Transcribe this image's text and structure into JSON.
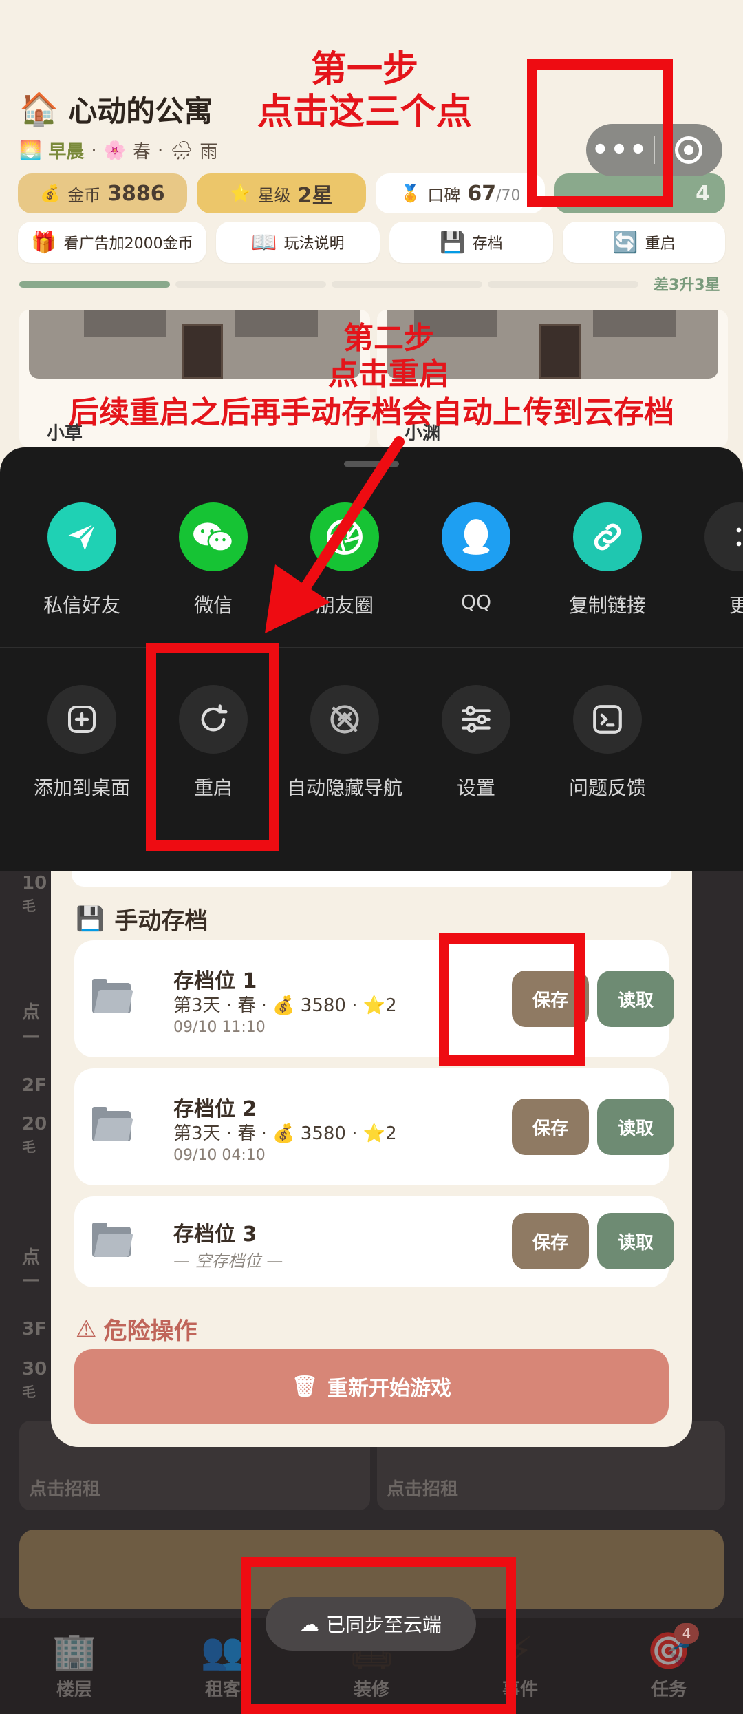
{
  "header": {
    "house_icon": "house-icon",
    "title": "心动的公寓",
    "time_of_day": "早晨",
    "season": "春",
    "weather": "雨",
    "separator": "·"
  },
  "capsule": {
    "more_label": "•••",
    "close_icon": "target-circle-icon"
  },
  "stats": {
    "gold_label": "金币",
    "gold_value": "3886",
    "star_label": "星级",
    "star_value": "2星",
    "rep_label": "口碑",
    "rep_value": "67",
    "rep_max": "/70",
    "green_value": "4"
  },
  "actions": {
    "ad": "看广告加2000金币",
    "guide": "玩法说明",
    "save": "存档",
    "restart": "重启"
  },
  "progress": {
    "filled_segments": 1,
    "total_segments": 4,
    "label": "差3升3星"
  },
  "rooms_top": [
    {
      "name": "小草"
    },
    {
      "name": "小渊"
    }
  ],
  "share_sheet": {
    "share_items": [
      {
        "label": "私信好友",
        "color": "#1fd1b4",
        "icon": "paper-plane-icon"
      },
      {
        "label": "微信",
        "color": "#16c334",
        "icon": "wechat-icon"
      },
      {
        "label": "朋友圈",
        "color": "#16c334",
        "icon": "moments-aperture-icon"
      },
      {
        "label": "QQ",
        "color": "#1e9ff2",
        "icon": "qq-penguin-icon"
      },
      {
        "label": "复制链接",
        "color": "#1fc7b0",
        "icon": "link-icon"
      },
      {
        "label": "更",
        "color": "#2c2c2c",
        "icon": "more-icon"
      }
    ],
    "tool_items": [
      {
        "label": "添加到桌面",
        "icon": "add-square-icon"
      },
      {
        "label": "重启",
        "icon": "refresh-icon"
      },
      {
        "label": "自动隐藏导航",
        "icon": "hide-nav-icon"
      },
      {
        "label": "设置",
        "icon": "sliders-icon"
      },
      {
        "label": "问题反馈",
        "icon": "terminal-feedback-icon"
      }
    ]
  },
  "save_modal": {
    "manual_title": "手动存档",
    "slots": [
      {
        "name": "存档位 1",
        "day": "第3天",
        "season": "春",
        "gold": "3580",
        "stars": "2",
        "date": "09/10 11:10",
        "empty": ""
      },
      {
        "name": "存档位 2",
        "day": "第3天",
        "season": "春",
        "gold": "3580",
        "stars": "2",
        "date": "09/10 04:10",
        "empty": ""
      },
      {
        "name": "存档位 3",
        "day": "",
        "season": "",
        "gold": "",
        "stars": "",
        "date": "",
        "empty": "— 空存档位 —"
      }
    ],
    "save_label": "保存",
    "load_label": "读取",
    "danger_title": "危险操作",
    "restart_label": "重新开始游戏"
  },
  "background_floors": {
    "tag_2f": "2F",
    "tag_3f": "3F",
    "room_prefix_1": "10",
    "room_prefix_2": "20",
    "room_prefix_3": "30",
    "rent_label": "点击招租",
    "rent_short": "点",
    "fur_short": "毛",
    "dash": "—"
  },
  "toast": {
    "label": "已同步至云端"
  },
  "nav": [
    {
      "label": "楼层",
      "icon": "building-icon"
    },
    {
      "label": "租客",
      "icon": "people-icon"
    },
    {
      "label": "装修",
      "icon": "sofa-icon"
    },
    {
      "label": "事件",
      "icon": "lightning-icon"
    },
    {
      "label": "任务",
      "icon": "dart-target-icon"
    }
  ],
  "nav_badge": "4",
  "tutorial": {
    "step1_line1": "第一步",
    "step1_line2": "点击这三个点",
    "step2_line1": "第二步",
    "step2_line2": "点击重启",
    "step2_line3": "后续重启之后再手动存档会自动上传到云存档"
  },
  "colors": {
    "annotation_red": "#ee0c12",
    "save_brown": "#8f7a63",
    "load_green": "#6e8b73",
    "danger_red": "#d78677"
  }
}
